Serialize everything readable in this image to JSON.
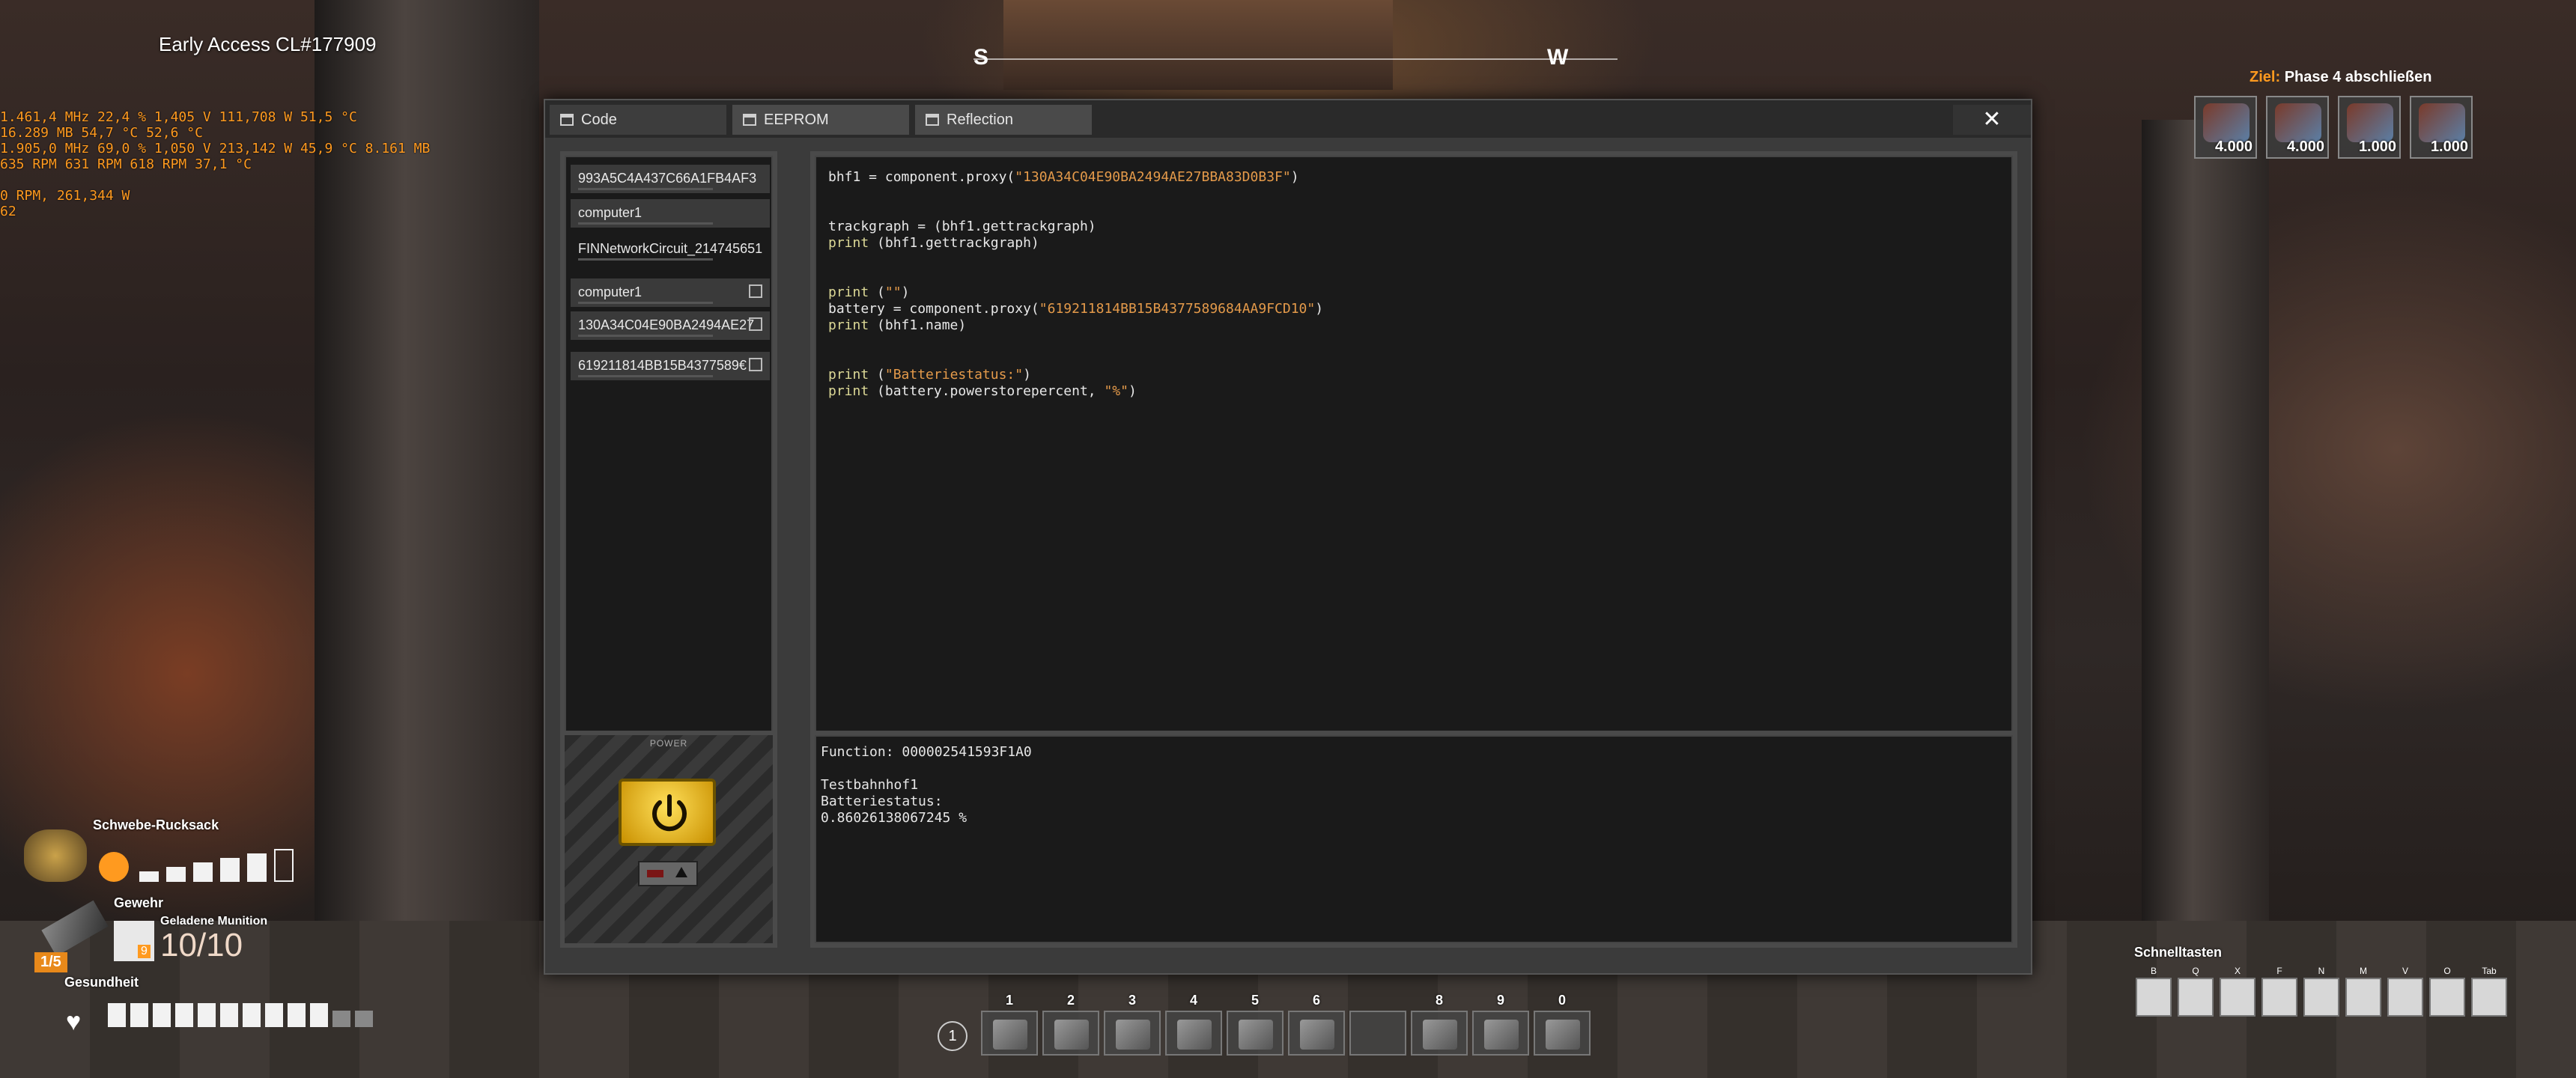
{
  "build_label": "Early Access CL#177909",
  "perf_lines": [
    "1.461,4 MHz 22,4 % 1,405 V 111,708 W 51,5 °C",
    "16.289 MB 54,7 °C 52,6 °C",
    "1.905,0 MHz 69,0 % 1,050 V 213,142 W 45,9 °C 8.161 MB",
    "635 RPM 631 RPM 618 RPM 37,1 °C",
    "",
    "0 RPM, 261,344 W",
    "62"
  ],
  "compass": {
    "s": "S",
    "w": "W"
  },
  "tabs": [
    {
      "label": "Code"
    },
    {
      "label": "EEPROM"
    },
    {
      "label": "Reflection"
    }
  ],
  "close_label": "✕",
  "components": [
    {
      "label": "993A5C4A437C66A1FB4AF3"
    },
    {
      "label": "computer1"
    },
    {
      "label": "FINNetworkCircuit_214745651"
    },
    {
      "label": "computer1"
    },
    {
      "label": "130A34C04E90BA2494AE27"
    },
    {
      "label": "619211814BB15B4377589€"
    }
  ],
  "code_lines": [
    [
      {
        "t": "bhf1 = component.proxy(",
        "c": ""
      },
      {
        "t": "\"130A34C04E90BA2494AE27BBA83D0B3F\"",
        "c": "str"
      },
      {
        "t": ")",
        "c": ""
      }
    ],
    [],
    [],
    [
      {
        "t": "trackgraph = (bhf1.gettrackgraph)",
        "c": ""
      }
    ],
    [
      {
        "t": "print",
        "c": "kw"
      },
      {
        "t": " (bhf1.gettrackgraph)",
        "c": ""
      }
    ],
    [],
    [],
    [
      {
        "t": "print",
        "c": "kw"
      },
      {
        "t": " (",
        "c": ""
      },
      {
        "t": "\"\"",
        "c": "str"
      },
      {
        "t": ")",
        "c": ""
      }
    ],
    [
      {
        "t": "battery = component.proxy(",
        "c": ""
      },
      {
        "t": "\"619211814BB15B4377589684AA9FCD10\"",
        "c": "str"
      },
      {
        "t": ")",
        "c": ""
      }
    ],
    [
      {
        "t": "print",
        "c": "kw"
      },
      {
        "t": " (bhf1.name)",
        "c": ""
      }
    ],
    [],
    [],
    [
      {
        "t": "print",
        "c": "kw"
      },
      {
        "t": " (",
        "c": ""
      },
      {
        "t": "\"Batteriestatus:\"",
        "c": "str"
      },
      {
        "t": ")",
        "c": ""
      }
    ],
    [
      {
        "t": "print",
        "c": "kw"
      },
      {
        "t": " (battery.powerstorepercent, ",
        "c": ""
      },
      {
        "t": "\"%\"",
        "c": "str"
      },
      {
        "t": ")",
        "c": ""
      }
    ]
  ],
  "console_text": "Function: 000002541593F1A0\n\nTestbahnhof1\nBatteriestatus:\n0.86026138067245 %",
  "power_label": "POWER",
  "goal": {
    "prefix": "Ziel:",
    "title": "Phase 4 abschließen",
    "items": [
      {
        "qty": "4.000",
        "icon": "motor-icon"
      },
      {
        "qty": "4.000",
        "icon": "computer-part-icon"
      },
      {
        "qty": "1.000",
        "icon": "heavy-frame-icon"
      },
      {
        "qty": "1.000",
        "icon": "supercomputer-icon"
      }
    ]
  },
  "hud": {
    "jetpack_label": "Schwebe-Rucksack",
    "jetpack_segments": [
      1,
      1,
      1,
      1,
      1,
      0
    ],
    "weapon_label": "Gewehr",
    "ammo_label": "Geladene Munition",
    "ammo_value": "10/10",
    "ammo_badge": "9",
    "weapon_counter": "1/5",
    "health_label": "Gesundheit",
    "health_segments": [
      1,
      1,
      1,
      1,
      1,
      1,
      1,
      1,
      1,
      1,
      0,
      0
    ]
  },
  "hotbar": {
    "page": "1",
    "slots": [
      "1",
      "2",
      "3",
      "4",
      "5",
      "6",
      "",
      "8",
      "9",
      "0"
    ]
  },
  "quick": {
    "title": "Schnelltasten",
    "keys": [
      "B",
      "Q",
      "X",
      "F",
      "N",
      "M",
      "V",
      "O",
      "Tab"
    ]
  }
}
